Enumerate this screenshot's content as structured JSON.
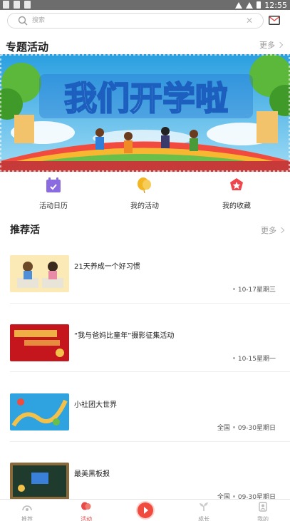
{
  "status_bar": {
    "time": "12:55"
  },
  "search": {
    "placeholder": "搜索"
  },
  "featured": {
    "title": "专题活动",
    "more": "更多",
    "banner_text": "我们开学啦"
  },
  "quick_links": [
    {
      "label": "活动日历",
      "icon": "calendar-icon"
    },
    {
      "label": "我的活动",
      "icon": "balloon-icon"
    },
    {
      "label": "我的收藏",
      "icon": "star-icon"
    }
  ],
  "recommended": {
    "title": "推荐活",
    "more": "更多",
    "items": [
      {
        "title": "21天养成一个好习惯",
        "location": "",
        "date": "10-17星期三"
      },
      {
        "title": "“我与爸妈比童年”摄影征集活动",
        "location": "",
        "date": "10-15星期一"
      },
      {
        "title": "小社团大世界",
        "location": "全国",
        "date": "09-30星期日"
      },
      {
        "title": "最美黑板报",
        "location": "全国",
        "date": "09-30星期日"
      }
    ]
  },
  "bottom_nav": [
    {
      "label": "推荐",
      "icon": "recommend-icon",
      "active": false
    },
    {
      "label": "活动",
      "icon": "balloon-icon",
      "active": true
    },
    {
      "label": "",
      "icon": "play-icon",
      "active": false
    },
    {
      "label": "成长",
      "icon": "sprout-icon",
      "active": false
    },
    {
      "label": "我的",
      "icon": "profile-icon",
      "active": false
    }
  ],
  "colors": {
    "accent": "#e84a4a",
    "calendar": "#8b6be0",
    "balloon": "#f3b623",
    "star": "#f0454b"
  }
}
